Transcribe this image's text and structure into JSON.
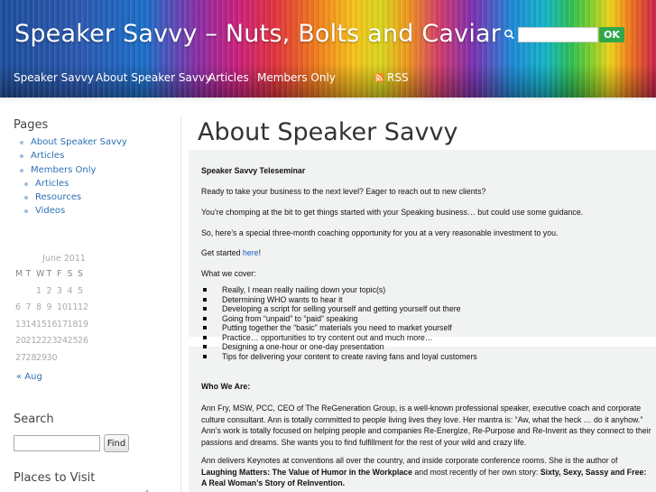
{
  "header": {
    "site_title": "Speaker Savvy – Nuts, Bolts and Caviar",
    "search_placeholder": "",
    "search_ok_label": "OK",
    "nav": [
      "Speaker Savvy",
      "About Speaker Savvy",
      "Articles",
      "Members Only"
    ],
    "rss_label": "RSS"
  },
  "sidebar": {
    "pages_heading": "Pages",
    "pages": [
      {
        "label": "About Speaker Savvy",
        "sub": false
      },
      {
        "label": "Articles",
        "sub": false
      },
      {
        "label": "Members Only",
        "sub": false
      },
      {
        "label": "Articles",
        "sub": true
      },
      {
        "label": "Resources",
        "sub": true
      },
      {
        "label": "Videos",
        "sub": true
      }
    ],
    "calendar": {
      "caption": "June 2011",
      "weekdays": [
        "M",
        "T",
        "W",
        "T",
        "F",
        "S",
        "S"
      ],
      "weeks": [
        [
          "",
          "",
          "1",
          "2",
          "3",
          "4",
          "5"
        ],
        [
          "6",
          "7",
          "8",
          "9",
          "10",
          "11",
          "12"
        ],
        [
          "13",
          "14",
          "15",
          "16",
          "17",
          "18",
          "19"
        ],
        [
          "20",
          "21",
          "22",
          "23",
          "24",
          "25",
          "26"
        ],
        [
          "27",
          "28",
          "29",
          "30",
          "",
          "",
          ""
        ]
      ],
      "prev_label": "« Aug"
    },
    "search_heading": "Search",
    "search_button": "Find",
    "places_heading": "Places to Visit"
  },
  "main": {
    "title": "About Speaker Savvy",
    "p1": "Speaker Savvy Teleseminar",
    "p2": "Ready to take your business to the next level? Eager to reach out to new clients?",
    "p3": "You’re chomping at the bit to get things started with your Speaking business… but could use some guidance.",
    "p4": "So, here’s a special three-month coaching opportunity for you at a very reasonable investment to you.",
    "p5_pre": "Get started ",
    "p5_link": "here",
    "p5_post": "!",
    "p6": "What we cover:",
    "bullets": [
      "Really, I mean really nailing down your topic(s)",
      "Determining WHO wants to hear it",
      "Developing a script for selling yourself and getting yourself out there",
      "Going from “unpaid” to “paid” speaking",
      "Putting together the “basic” materials  you need to market yourself",
      "Practice… opportunities to try content out and much more…",
      "Designing a one-hour or one-day presentation",
      "Tips for delivering your content to create raving fans and loyal customers"
    ],
    "who_heading": "Who We Are:",
    "who_p1": "Ann Fry, MSW, PCC, CEO of The ReGeneration Group,  is a well-known professional speaker, executive coach and corporate culture consultant. Ann is totally committed to people living lives they love. Her mantra is: “Aw, what the heck … do it anyhow.” Ann’s work is totally focused on helping people and companies Re-Energize, Re-Purpose and Re-Invent as they connect to their passions and dreams. She wants you to find fulfillment for the rest of your wild and crazy life.",
    "who_p2_pre": "Ann delivers Keynotes at conventions all over the country, and inside corporate conference rooms. She is the author of ",
    "who_p2_book1": "Laughing Matters: The Value of Humor in the Workplace",
    "who_p2_mid": " and most recently of her own story: ",
    "who_p2_book2": "Sixty, Sexy, Sassy and Free: A Real Woman’s Story of ReInvention."
  }
}
